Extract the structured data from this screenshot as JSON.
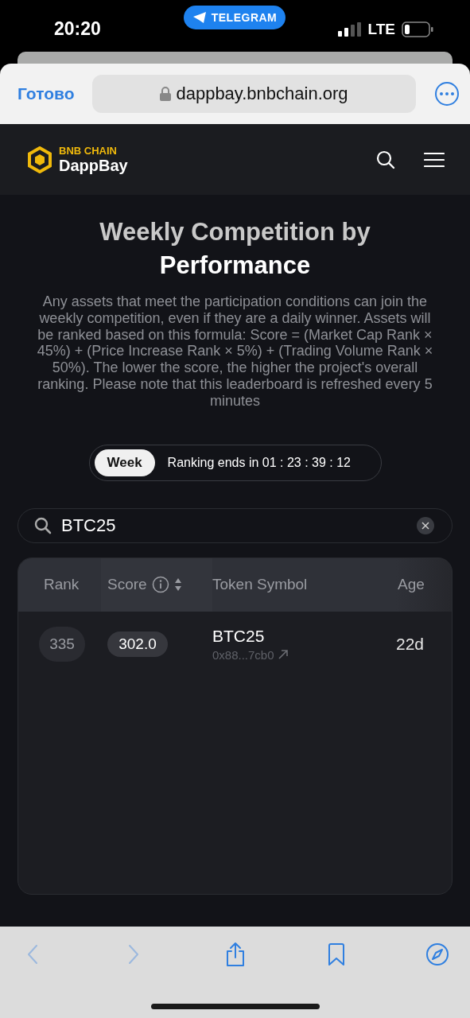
{
  "status_bar": {
    "time": "20:20",
    "app_pill": "TELEGRAM",
    "network": "LTE"
  },
  "browser_bar": {
    "done": "Готово",
    "url": "dappbay.bnbchain.org"
  },
  "site_header": {
    "brand": "BNB CHAIN",
    "name": "DappBay"
  },
  "title": {
    "line1": "Weekly Competition by",
    "line2": "Performance"
  },
  "description": "Any assets that meet the participation conditions can join the weekly competition, even if they are a daily winner. Assets will be ranked based on this formula: Score = (Market Cap Rank × 45%) + (Price Increase Rank × 5%) + (Trading Volume Rank × 50%). The lower the score, the higher the project's overall ranking. Please note that this leaderboard is refreshed every 5 minutes",
  "period_tabs": [
    {
      "label": "Week",
      "selected": true
    }
  ],
  "countdown": "Ranking ends in 01 : 23 : 39 : 12",
  "search": {
    "value": "BTC25"
  },
  "table": {
    "columns": [
      "Rank",
      "Score",
      "Token Symbol",
      "Age"
    ],
    "rows": [
      {
        "rank": "335",
        "score": "302.0",
        "symbol": "BTC25",
        "address": "0x88...7cb0",
        "age": "22d"
      }
    ]
  },
  "toolbar": [
    {
      "kind": "back",
      "disabled": true
    },
    {
      "kind": "forward",
      "disabled": true
    },
    {
      "kind": "share",
      "disabled": false
    },
    {
      "kind": "bookmarks",
      "disabled": false
    },
    {
      "kind": "compass",
      "disabled": false
    }
  ]
}
